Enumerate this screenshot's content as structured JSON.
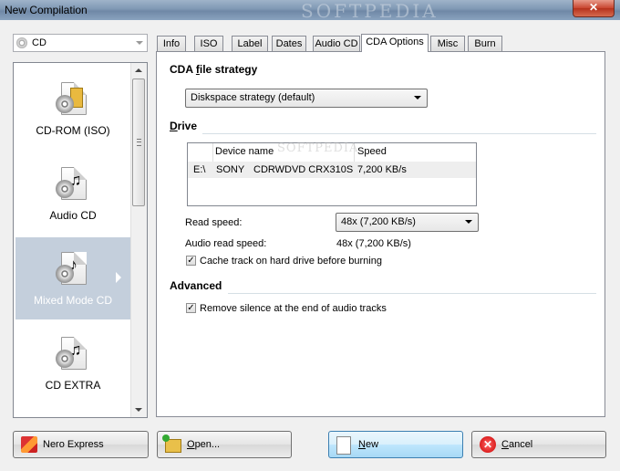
{
  "window": {
    "title": "New Compilation",
    "watermark": "SOFTPEDIA",
    "close_label": "✕"
  },
  "sidebar": {
    "type_combo_value": "CD",
    "items": [
      {
        "label": "CD-ROM (ISO)",
        "icon": "cd-rom-iso-icon"
      },
      {
        "label": "Audio CD",
        "icon": "audio-cd-icon"
      },
      {
        "label": "Mixed Mode CD",
        "icon": "mixed-mode-cd-icon",
        "selected": true
      },
      {
        "label": "CD EXTRA",
        "icon": "cd-extra-icon"
      }
    ]
  },
  "tabs": [
    "Info",
    "ISO",
    "Label",
    "Dates",
    "Audio CD",
    "CDA Options",
    "Misc",
    "Burn"
  ],
  "active_tab": "CDA Options",
  "cda": {
    "strategy_title_prefix": "CDA ",
    "strategy_title_u": "f",
    "strategy_title_suffix": "ile strategy",
    "strategy_value": "Diskspace strategy (default)",
    "drive_title_u": "D",
    "drive_title_suffix": "rive",
    "table_watermark": "SOFTPEDIA",
    "table_headers": [
      "Device name",
      "Speed"
    ],
    "drive_row": {
      "letter": "E:\\",
      "vendor": "SONY",
      "model": "CDRWDVD CRX310S",
      "speed": "7,200 KB/s"
    },
    "read_speed_label": "Read speed:",
    "read_speed_value": "48x (7,200 KB/s)",
    "audio_read_speed_label": "Audio read speed:",
    "audio_read_speed_value": "48x (7,200 KB/s)",
    "cache_track_label": "Cache track on hard drive before burning",
    "cache_track_checked": true,
    "advanced_title": "Advanced",
    "remove_silence_label": "Remove silence at the end of audio tracks",
    "remove_silence_checked": true
  },
  "buttons": {
    "nero_express": "Nero Express",
    "open_u": "O",
    "open_rest": "pen...",
    "new_u": "N",
    "new_rest": "ew",
    "cancel_u": "C",
    "cancel_rest": "ancel"
  }
}
